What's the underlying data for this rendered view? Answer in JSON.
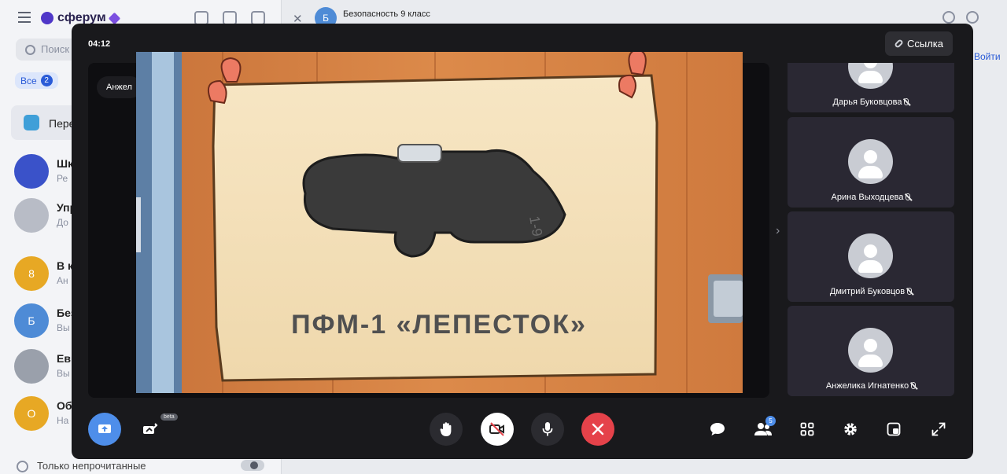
{
  "app": {
    "brand": "сферум",
    "search_placeholder": "Поиск",
    "filter_all_label": "Все",
    "filter_all_count": "2",
    "folder_label": "Пере",
    "chats": [
      {
        "initial": "",
        "name": "Шк",
        "sub": "Ре",
        "color": "#3a52c9"
      },
      {
        "initial": "",
        "name": "Упр",
        "sub": "До",
        "color": "#b8bcc6"
      },
      {
        "initial": "8",
        "name": "В к",
        "sub": "Ан",
        "color": "#e7a824"
      },
      {
        "initial": "Б",
        "name": "Без",
        "sub": "Вы",
        "color": "#4e8bd6"
      },
      {
        "initial": "",
        "name": "Евг",
        "sub": "Вы",
        "color": "#9aa0ab"
      },
      {
        "initial": "О",
        "name": "Об",
        "sub": "На",
        "color": "#e7a824"
      }
    ],
    "unread_only_label": "Только непрочитанные",
    "chat_header_initial": "Б",
    "chat_header_title": "Безопасность 9 класс",
    "join_link": "Войти"
  },
  "call": {
    "timer": "04:12",
    "link_button_label": "Ссылка",
    "stage_name_tag": "Анжел",
    "slide": {
      "caption": "ПФМ-1 «ЛЕПЕСТОК»",
      "marking": "1-9"
    },
    "participants": [
      {
        "name": "Дарья Буковцова"
      },
      {
        "name": "Арина Выходцева"
      },
      {
        "name": "Дмитрий Буковцов"
      },
      {
        "name": "Анжелика Игнатенко"
      }
    ],
    "controls": {
      "beta_badge": "beta",
      "participants_count": "5"
    },
    "colors": {
      "accent": "#4e8eea",
      "end_call": "#e5424a",
      "window_bg": "#19191c"
    }
  }
}
